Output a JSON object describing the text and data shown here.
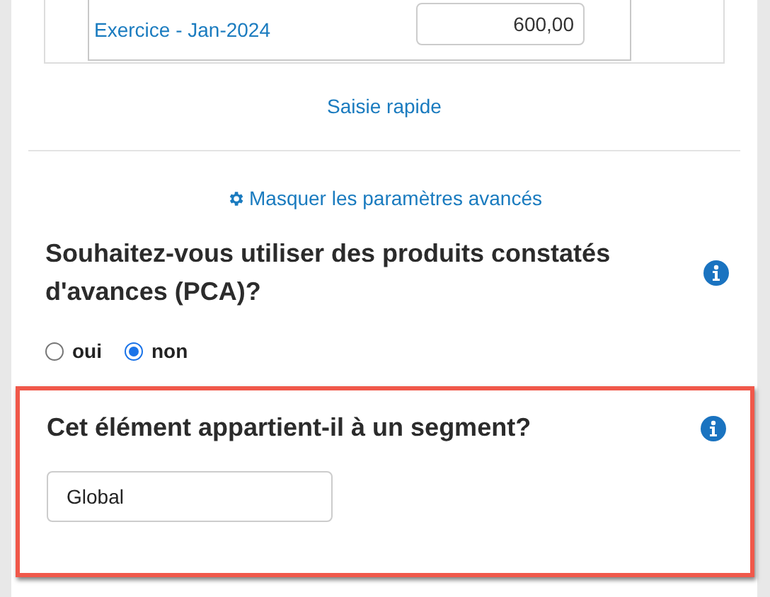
{
  "period_row": {
    "label": "Exercice - Jan-2024",
    "amount": "600,00"
  },
  "quick_entry_link": "Saisie rapide",
  "advanced_link": "Masquer les paramètres avancés",
  "pca_question": {
    "text": "Souhaitez-vous utiliser des produits constatés d'avances (PCA)?",
    "options": [
      {
        "label": "oui",
        "selected": false
      },
      {
        "label": "non",
        "selected": true
      }
    ]
  },
  "segment_question": {
    "text": "Cet élément appartient-il à un segment?",
    "highlighted": true,
    "value": "Global"
  }
}
